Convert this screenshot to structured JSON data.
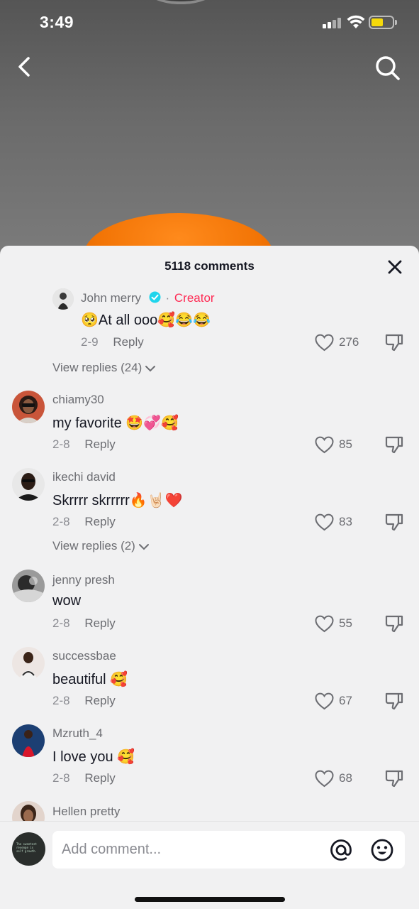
{
  "status_bar": {
    "time": "3:49"
  },
  "header": {
    "back_icon": "chevron-left-icon",
    "search_icon": "search-icon"
  },
  "sheet": {
    "title": "5118 comments",
    "close_icon": "close-icon"
  },
  "comments": [
    {
      "username": "John merry",
      "verified": true,
      "creator_label": "Creator",
      "text": "🥺At all ooo🥰😂😂",
      "date": "2-9",
      "reply_label": "Reply",
      "likes": "276",
      "view_replies": "View replies (24)"
    },
    {
      "username": "chiamy30",
      "text": "my favorite 🤩💞🥰",
      "date": "2-8",
      "reply_label": "Reply",
      "likes": "85"
    },
    {
      "username": "ikechi david",
      "text": "Skrrrr skrrrrr🔥🤘🏻❤️",
      "date": "2-8",
      "reply_label": "Reply",
      "likes": "83",
      "view_replies": "View replies (2)"
    },
    {
      "username": "jenny presh",
      "text": "wow",
      "date": "2-8",
      "reply_label": "Reply",
      "likes": "55"
    },
    {
      "username": "successbae",
      "text": "beautiful 🥰",
      "date": "2-8",
      "reply_label": "Reply",
      "likes": "67"
    },
    {
      "username": "Mzruth_4",
      "text": "I love you 🥰",
      "date": "2-8",
      "reply_label": "Reply",
      "likes": "68"
    },
    {
      "username": "Hellen pretty"
    }
  ],
  "composer": {
    "placeholder": "Add comment...",
    "avatar_text": "The sweetest revenge is self growth.",
    "mention_icon": "at-icon",
    "emoji_icon": "emoji-icon"
  },
  "colors": {
    "accent": "#fe2c55",
    "verified": "#20d5ec",
    "battery": "#f5d90a",
    "blob": "#f27405"
  }
}
